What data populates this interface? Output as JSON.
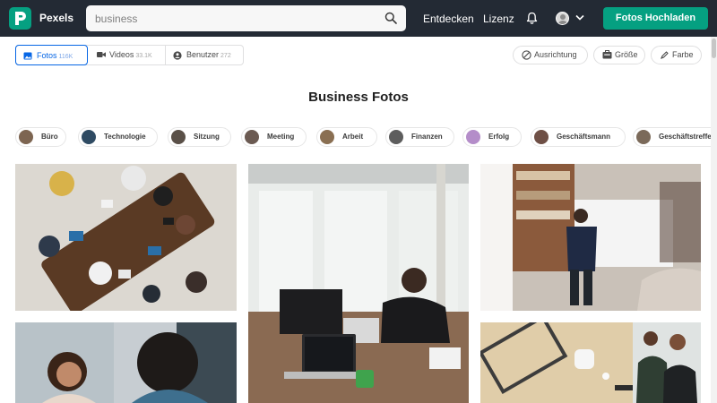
{
  "app": {
    "brand": "Pexels",
    "upload_label": "Fotos Hochladen",
    "nav": [
      "Entdecken",
      "Lizenz"
    ]
  },
  "search": {
    "value": "business",
    "placeholder": "business"
  },
  "media_tabs": [
    {
      "label": "Fotos",
      "count": "116K",
      "icon": "image-icon",
      "active": true
    },
    {
      "label": "Videos",
      "count": "33.1K",
      "icon": "video-icon",
      "active": false
    },
    {
      "label": "Benutzer",
      "count": "272",
      "icon": "user-icon",
      "active": false
    }
  ],
  "filters": [
    {
      "label": "Ausrichtung",
      "icon": "orientation-icon"
    },
    {
      "label": "Größe",
      "icon": "size-icon"
    },
    {
      "label": "Farbe",
      "icon": "color-icon"
    }
  ],
  "page_title": "Business Fotos",
  "related": [
    {
      "label": "Büro"
    },
    {
      "label": "Technologie"
    },
    {
      "label": "Sitzung"
    },
    {
      "label": "Meeting"
    },
    {
      "label": "Arbeit"
    },
    {
      "label": "Finanzen"
    },
    {
      "label": "Erfolg"
    },
    {
      "label": "Geschäftsmann"
    },
    {
      "label": "Geschäftstreffen"
    }
  ],
  "colors": {
    "topbar": "#232a34",
    "accent": "#05a081",
    "active_tab": "#0666e5"
  }
}
